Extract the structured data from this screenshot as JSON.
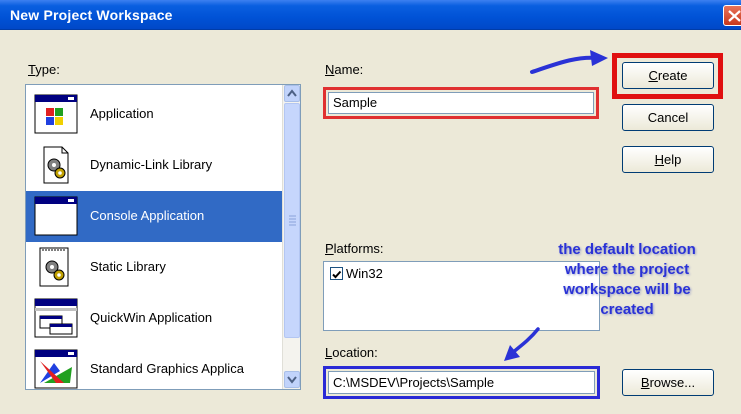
{
  "window": {
    "title": "New Project Workspace"
  },
  "type_section": {
    "label": "Type:",
    "label_ul": "T",
    "label_rest": "ype:",
    "items": [
      {
        "label": "Application",
        "icon": "application-icon",
        "selected": false
      },
      {
        "label": "Dynamic-Link Library",
        "icon": "dll-icon",
        "selected": false
      },
      {
        "label": "Console Application",
        "icon": "console-icon",
        "selected": true
      },
      {
        "label": "Static Library",
        "icon": "static-library-icon",
        "selected": false
      },
      {
        "label": "QuickWin Application",
        "icon": "quickwin-icon",
        "selected": false
      },
      {
        "label": "Standard Graphics Applica",
        "icon": "graphics-app-icon",
        "selected": false
      }
    ]
  },
  "name_section": {
    "label_ul": "N",
    "label_rest": "ame:",
    "value": "Sample"
  },
  "platforms_section": {
    "label_ul": "P",
    "label_rest": "latforms:",
    "items": [
      {
        "label": "Win32",
        "checked": true
      }
    ]
  },
  "location_section": {
    "label_ul": "L",
    "label_rest": "ocation:",
    "value": "C:\\MSDEV\\Projects\\Sample"
  },
  "buttons": {
    "create_ul": "C",
    "create_rest": "reate",
    "cancel": "Cancel",
    "help_ul": "H",
    "help_rest": "elp",
    "browse_ul": "B",
    "browse_rest": "rowse..."
  },
  "annotation": {
    "lines": [
      "the default location",
      "where the project",
      "workspace will be",
      "created"
    ],
    "color": "#2a32d6"
  },
  "colors": {
    "selection": "#316ac5",
    "highlight_red": "#e01010",
    "highlight_blue": "#2a2ad6"
  }
}
